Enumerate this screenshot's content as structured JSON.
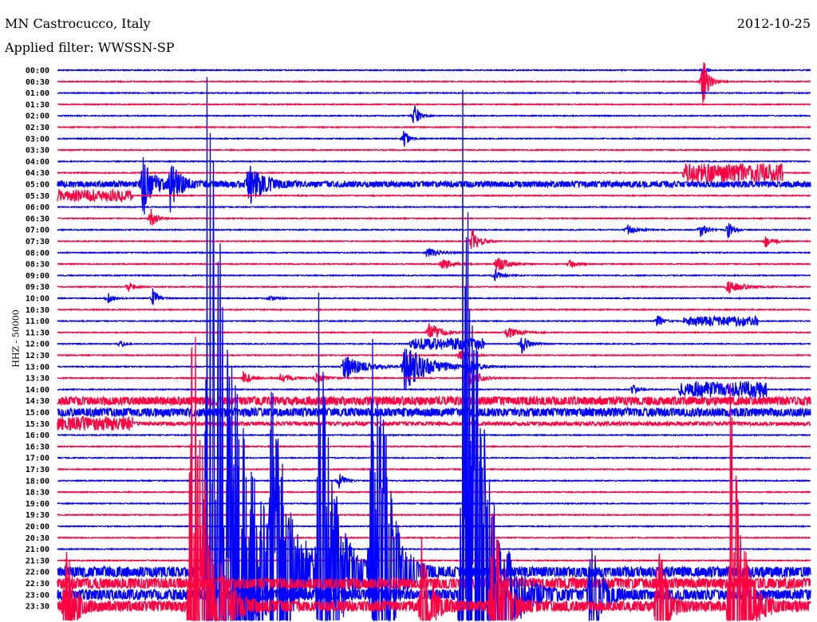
{
  "header": {
    "title": "MN Castrocucco, Italy",
    "filter": "Applied filter: WWSSN-SP",
    "date": "2012-10-25"
  },
  "chart_data": {
    "type": "line",
    "subtype": "helicorder",
    "ylabel": "HHZ - 50000",
    "minutes_per_row": 30,
    "colors": [
      "#0000ff",
      "#ff0040"
    ],
    "row_labels": [
      "00:00",
      "00:30",
      "01:00",
      "01:30",
      "02:00",
      "02:30",
      "03:00",
      "03:30",
      "04:00",
      "04:30",
      "05:00",
      "05:30",
      "06:00",
      "06:30",
      "07:00",
      "07:30",
      "08:00",
      "08:30",
      "09:00",
      "09:30",
      "10:00",
      "10:30",
      "11:00",
      "11:30",
      "12:00",
      "12:30",
      "13:00",
      "13:30",
      "14:00",
      "14:30",
      "15:00",
      "15:30",
      "16:00",
      "16:30",
      "17:00",
      "17:30",
      "18:00",
      "18:30",
      "19:00",
      "19:30",
      "20:00",
      "20:30",
      "21:00",
      "21:30",
      "22:00",
      "22:30",
      "23:00",
      "23:30"
    ],
    "background_noise": [
      {
        "rows": [
          29,
          30
        ],
        "amplitude": 0.35
      },
      {
        "rows": [
          31
        ],
        "amplitude": 0.15
      },
      {
        "rows": [
          44,
          45,
          46,
          47
        ],
        "amplitude": 0.45
      },
      {
        "rows": [
          10
        ],
        "amplitude": 0.25
      }
    ],
    "events": [
      {
        "row": 0,
        "minute": 25.7,
        "amplitude": 0.3,
        "duration": 0.5
      },
      {
        "row": 1,
        "minute": 25.7,
        "amplitude": 2.5,
        "duration": 0.6
      },
      {
        "row": 4,
        "minute": 14.2,
        "amplitude": 1.3,
        "duration": 0.5
      },
      {
        "row": 6,
        "minute": 13.8,
        "amplitude": 1.0,
        "duration": 0.5
      },
      {
        "row": 9,
        "minute": 26.9,
        "amplitude": 0.8,
        "duration": 4
      },
      {
        "row": 10,
        "minute": 3.4,
        "amplitude": 3.0,
        "duration": 1
      },
      {
        "row": 10,
        "minute": 4.5,
        "amplitude": 2.5,
        "duration": 1
      },
      {
        "row": 10,
        "minute": 7.6,
        "amplitude": 2.0,
        "duration": 1.5
      },
      {
        "row": 11,
        "minute": 0.0,
        "amplitude": 0.5,
        "duration": 6
      },
      {
        "row": 13,
        "minute": 3.7,
        "amplitude": 1.0,
        "duration": 0.6
      },
      {
        "row": 14,
        "minute": 22.7,
        "amplitude": 0.5,
        "duration": 1
      },
      {
        "row": 14,
        "minute": 25.6,
        "amplitude": 0.8,
        "duration": 0.6
      },
      {
        "row": 14,
        "minute": 26.7,
        "amplitude": 0.8,
        "duration": 0.6
      },
      {
        "row": 15,
        "minute": 16.5,
        "amplitude": 1.2,
        "duration": 0.8
      },
      {
        "row": 15,
        "minute": 28.2,
        "amplitude": 0.6,
        "duration": 0.8
      },
      {
        "row": 16,
        "minute": 14.7,
        "amplitude": 0.5,
        "duration": 1.2
      },
      {
        "row": 17,
        "minute": 15.3,
        "amplitude": 0.6,
        "duration": 1
      },
      {
        "row": 17,
        "minute": 17.5,
        "amplitude": 0.9,
        "duration": 1
      },
      {
        "row": 17,
        "minute": 20.4,
        "amplitude": 0.4,
        "duration": 0.8
      },
      {
        "row": 18,
        "minute": 17.4,
        "amplitude": 0.5,
        "duration": 0.8
      },
      {
        "row": 19,
        "minute": 2.8,
        "amplitude": 0.6,
        "duration": 0.6
      },
      {
        "row": 19,
        "minute": 26.7,
        "amplitude": 0.7,
        "duration": 1.5
      },
      {
        "row": 20,
        "minute": 2.0,
        "amplitude": 0.5,
        "duration": 0.6
      },
      {
        "row": 20,
        "minute": 3.8,
        "amplitude": 0.9,
        "duration": 0.5
      },
      {
        "row": 20,
        "minute": 8.4,
        "amplitude": 0.3,
        "duration": 0.8
      },
      {
        "row": 22,
        "minute": 23.9,
        "amplitude": 0.6,
        "duration": 0.6
      },
      {
        "row": 22,
        "minute": 26.4,
        "amplitude": 0.4,
        "duration": 3
      },
      {
        "row": 23,
        "minute": 14.8,
        "amplitude": 1.0,
        "duration": 1.2
      },
      {
        "row": 23,
        "minute": 17.9,
        "amplitude": 0.5,
        "duration": 1.5
      },
      {
        "row": 24,
        "minute": 2.5,
        "amplitude": 0.4,
        "duration": 0.4
      },
      {
        "row": 24,
        "minute": 15.5,
        "amplitude": 0.5,
        "duration": 3
      },
      {
        "row": 24,
        "minute": 18.5,
        "amplitude": 0.9,
        "duration": 0.8
      },
      {
        "row": 25,
        "minute": 16.0,
        "amplitude": 0.5,
        "duration": 1
      },
      {
        "row": 26,
        "minute": 11.4,
        "amplitude": 1.2,
        "duration": 2
      },
      {
        "row": 26,
        "minute": 13.8,
        "amplitude": 2.2,
        "duration": 2.5
      },
      {
        "row": 26,
        "minute": 16.4,
        "amplitude": 0.6,
        "duration": 1
      },
      {
        "row": 27,
        "minute": 7.4,
        "amplitude": 0.6,
        "duration": 1
      },
      {
        "row": 27,
        "minute": 8.9,
        "amplitude": 0.5,
        "duration": 1
      },
      {
        "row": 27,
        "minute": 10.3,
        "amplitude": 0.5,
        "duration": 1
      },
      {
        "row": 27,
        "minute": 16.3,
        "amplitude": 1.0,
        "duration": 1.2
      },
      {
        "row": 28,
        "minute": 22.9,
        "amplitude": 0.5,
        "duration": 0.6
      },
      {
        "row": 28,
        "minute": 26.5,
        "amplitude": 0.7,
        "duration": 3.5
      },
      {
        "row": 31,
        "minute": 1.5,
        "amplitude": 0.5,
        "duration": 3
      },
      {
        "row": 36,
        "minute": 11.2,
        "amplitude": 0.8,
        "duration": 0.6
      },
      {
        "row": 44,
        "minute": 5.9,
        "amplitude": 52,
        "duration": 3
      },
      {
        "row": 44,
        "minute": 8.5,
        "amplitude": 18,
        "duration": 1.5
      },
      {
        "row": 44,
        "minute": 10.4,
        "amplitude": 24,
        "duration": 1.5
      },
      {
        "row": 44,
        "minute": 12.5,
        "amplitude": 26,
        "duration": 1.2
      },
      {
        "row": 44,
        "minute": 12.9,
        "amplitude": 12,
        "duration": 1.2
      },
      {
        "row": 46,
        "minute": 16.1,
        "amplitude": 52,
        "duration": 2
      },
      {
        "row": 46,
        "minute": 21.2,
        "amplitude": 6,
        "duration": 1
      },
      {
        "row": 47,
        "minute": 5.3,
        "amplitude": 36,
        "duration": 1.5
      },
      {
        "row": 47,
        "minute": 14.5,
        "amplitude": 6,
        "duration": 1
      },
      {
        "row": 47,
        "minute": 17.3,
        "amplitude": 14,
        "duration": 1
      },
      {
        "row": 47,
        "minute": 23.9,
        "amplitude": 8,
        "duration": 0.8
      },
      {
        "row": 47,
        "minute": 26.8,
        "amplitude": 20,
        "duration": 1.2
      },
      {
        "row": 47,
        "minute": 0.3,
        "amplitude": 7,
        "duration": 0.8
      }
    ]
  }
}
